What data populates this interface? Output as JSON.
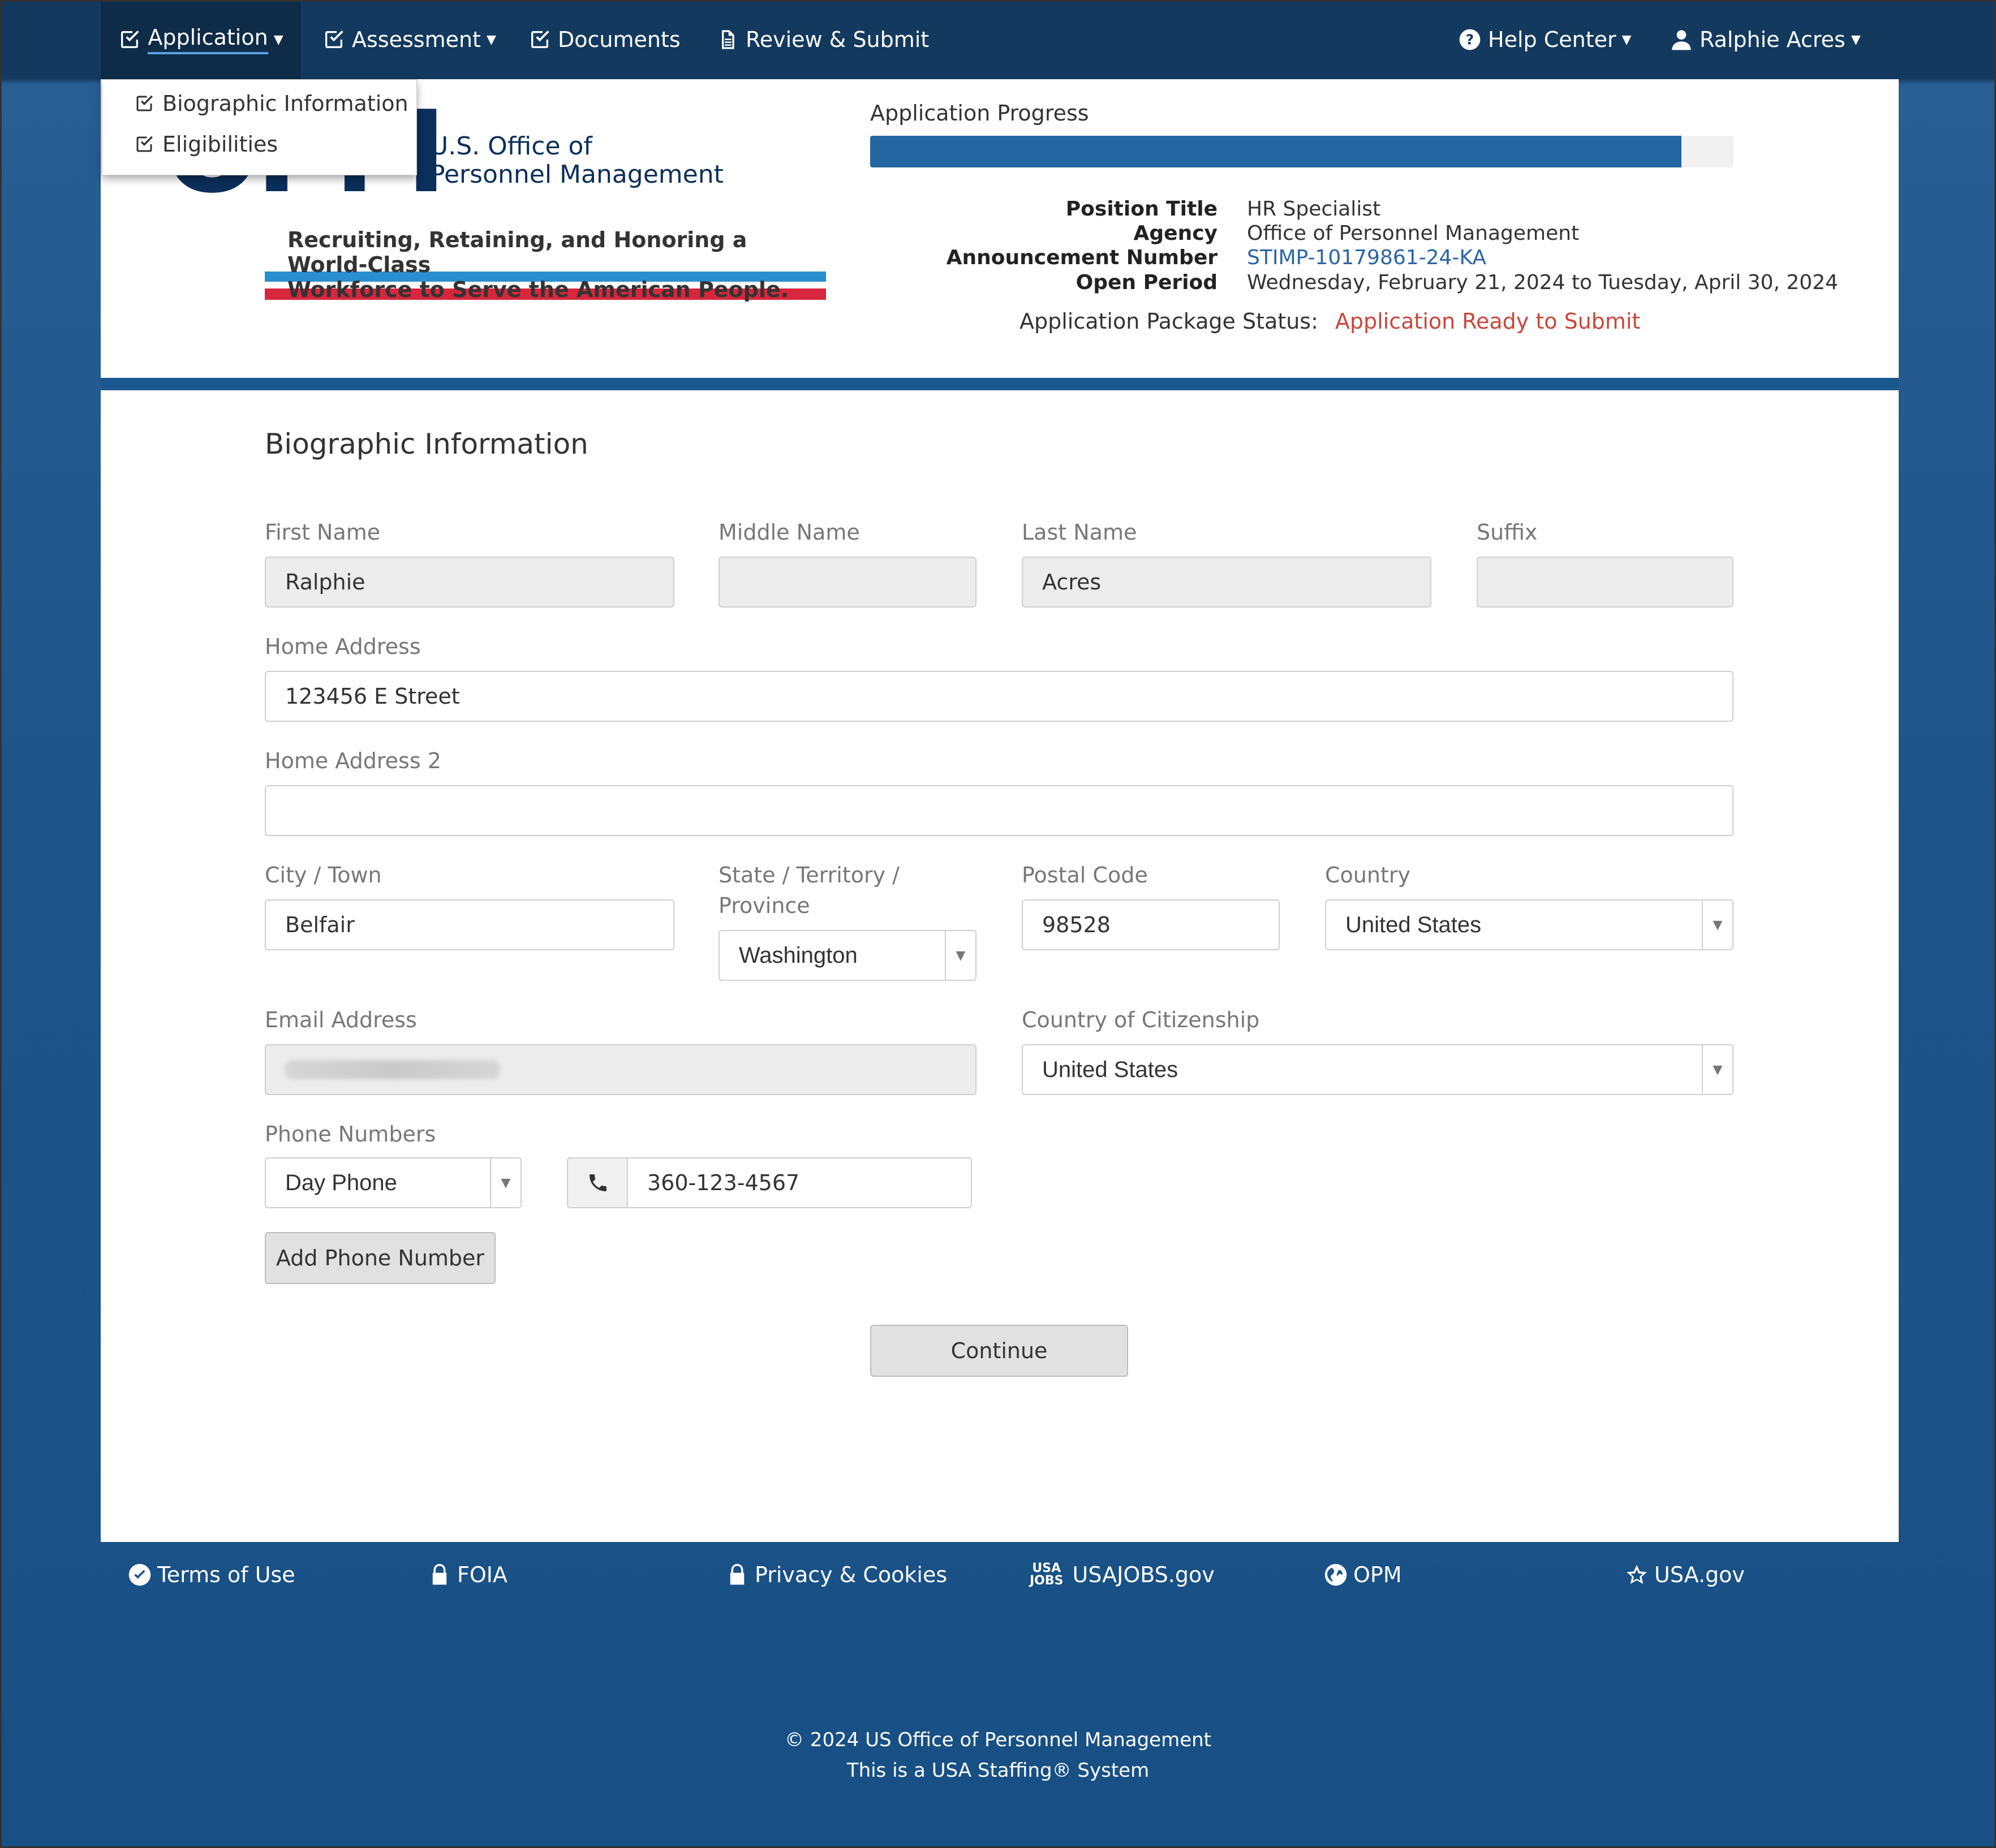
{
  "nav": {
    "application": "Application",
    "assessment": "Assessment",
    "documents": "Documents",
    "review": "Review & Submit",
    "help": "Help Center",
    "user": "Ralphie Acres"
  },
  "app_menu": {
    "items": [
      "Biographic Information",
      "Eligibilities"
    ]
  },
  "logo": {
    "letters": "OPM",
    "name_line1": "U.S. Office of",
    "name_line2": "Personnel Management",
    "tagline_line1": "Recruiting, Retaining, and Honoring a World-Class",
    "tagline_line2": "Workforce to Serve the American People."
  },
  "progress": {
    "label": "Application Progress",
    "percent": 94
  },
  "job": {
    "position_title_label": "Position Title",
    "position_title": "HR Specialist",
    "agency_label": "Agency",
    "agency": "Office of Personnel Management",
    "announcement_label": "Announcement Number",
    "announcement": "STIMP-10179861-24-KA",
    "open_period_label": "Open Period",
    "open_period": "Wednesday, February 21, 2024 to Tuesday, April 30, 2024",
    "status_label": "Application Package Status:",
    "status": "Application Ready to Submit"
  },
  "form": {
    "title": "Biographic Information",
    "first_name_label": "First Name",
    "first_name": "Ralphie",
    "middle_name_label": "Middle Name",
    "middle_name": "",
    "last_name_label": "Last Name",
    "last_name": "Acres",
    "suffix_label": "Suffix",
    "suffix": "",
    "address_label": "Home Address",
    "address": "123456 E Street",
    "address2_label": "Home Address 2",
    "address2": "",
    "city_label": "City / Town",
    "city": "Belfair",
    "state_label_1": "State / Territory /",
    "state_label_2": "Province",
    "state": "Washington",
    "postal_label": "Postal Code",
    "postal": "98528",
    "country_label": "Country",
    "country": "United States",
    "email_label": "Email Address",
    "citizenship_label": "Country of Citizenship",
    "citizenship": "United States",
    "phone_label": "Phone Numbers",
    "phone_type": "Day Phone",
    "phone": "360-123-4567",
    "add_phone": "Add Phone Number",
    "continue": "Continue"
  },
  "footer": {
    "terms": "Terms of Use",
    "foia": "FOIA",
    "privacy": "Privacy & Cookies",
    "usajobs_mark_1": "USA",
    "usajobs_mark_2": "JOBS",
    "usajobs": "USAJOBS.gov",
    "opm": "OPM",
    "usagov": "USA.gov",
    "copyright": "© 2024 US Office of Personnel Management",
    "system": "This is a USA Staffing® System"
  },
  "colors": {
    "nav_bg": "#133a5e",
    "accent_blue": "#2466a1",
    "status_red": "#c8473b",
    "link_blue": "#2a64a6"
  }
}
